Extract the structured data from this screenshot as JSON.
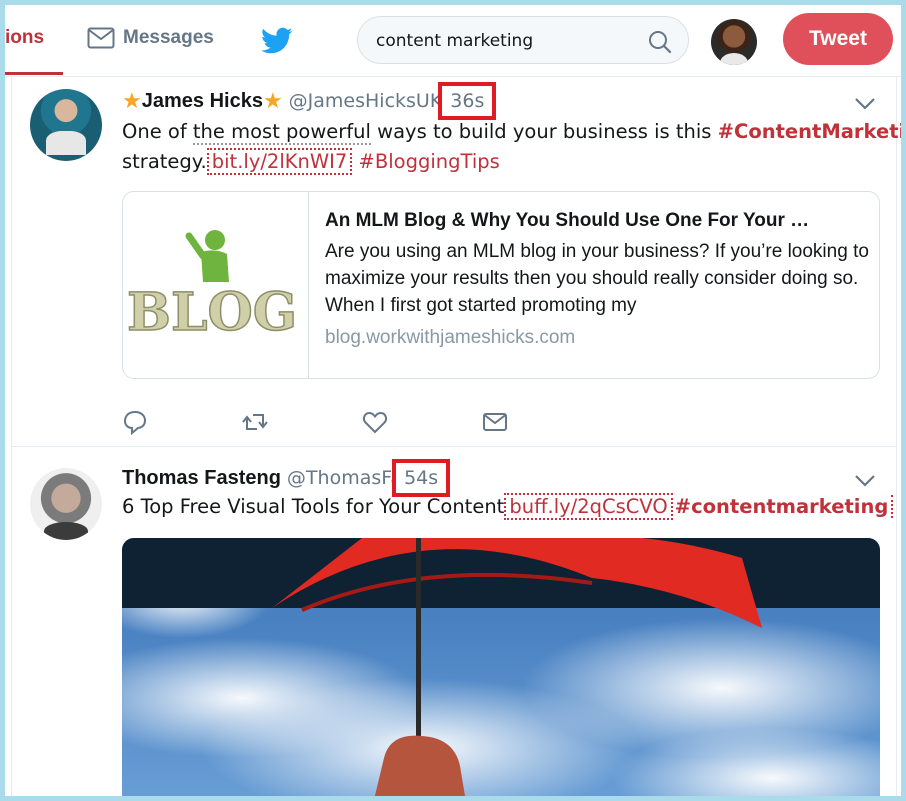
{
  "nav": {
    "notifications_label": "ions",
    "messages_label": "Messages",
    "search_value": "content marketing",
    "tweet_label": "Tweet"
  },
  "colors": {
    "accent": "#c0313a",
    "highlight_box": "#e01b24",
    "brand_blue": "#1da1f2"
  },
  "tweets": [
    {
      "name": "James Hicks",
      "handle": "@JamesHicksUK",
      "time": "36s",
      "text": {
        "line1_a": "One of ",
        "line1_b": "the most powerful",
        "line1_c": " ways to build your business is this ",
        "hashtag1": "#ContentMarketing",
        "line2_a": "strategy.",
        "link": "bit.ly/2lKnWI7",
        "hashtag2": "#BloggingTips"
      },
      "card": {
        "image_text": "BLOG",
        "title": "An MLM Blog & Why You Should Use One For Your …",
        "description": "Are you using an MLM blog in your business? If you’re looking to maximize your results then you should really consider doing so.   When I first got started promoting my",
        "url": "blog.workwithjameshicks.com"
      }
    },
    {
      "name": "Thomas Fasteng",
      "handle": "@ThomasFa",
      "time": "54s",
      "text": {
        "main": "6 Top Free Visual Tools for Your Content",
        "link": "buff.ly/2qCsCVO",
        "hashtag": "#contentmarketing"
      }
    }
  ]
}
